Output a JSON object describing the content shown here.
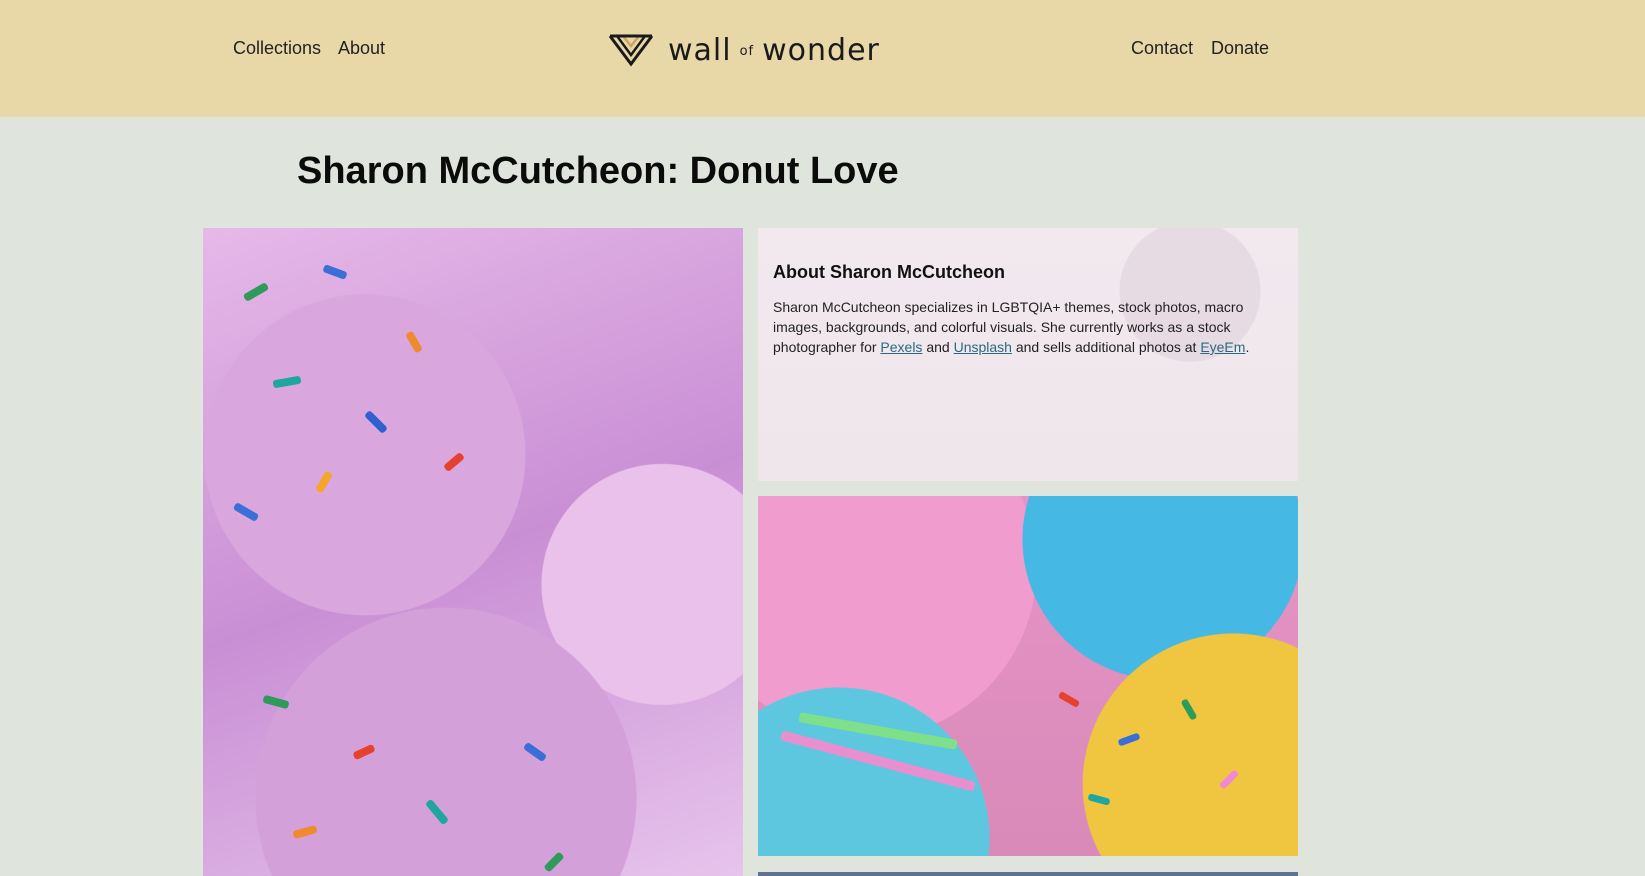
{
  "header": {
    "nav_left": [
      "Collections",
      "About"
    ],
    "nav_right": [
      "Contact",
      "Donate"
    ],
    "logo": {
      "word1": "wall",
      "word2": "of",
      "word3": "wonder",
      "icon": "wall-of-wonder-logo-icon"
    }
  },
  "page": {
    "title": "Sharon McCutcheon: Donut Love"
  },
  "about": {
    "heading": "About Sharon McCutcheon",
    "text_before": "Sharon McCutcheon specializes in LGBTQIA+ themes, stock photos, macro images, backgrounds, and colorful visuals. She currently works as a stock photographer for ",
    "link1": "Pexels",
    "and": " and ",
    "link2": "Unsplash",
    "text_middle": " and sells additional photos at ",
    "link3": "EyeEm",
    "period": "."
  },
  "colors": {
    "header_bg": "#e9d8a7",
    "page_bg": "#dfe4dc",
    "link": "#2a6a80"
  }
}
